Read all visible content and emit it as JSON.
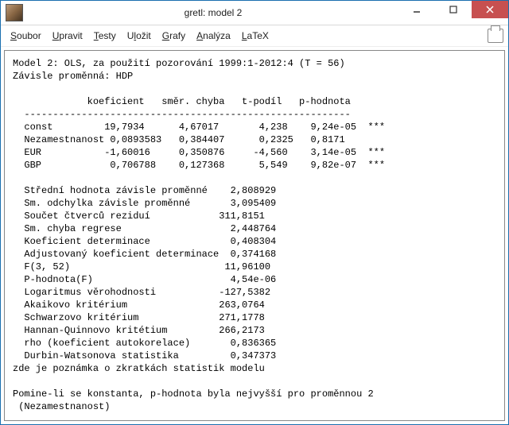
{
  "window": {
    "title": "gretl: model 2"
  },
  "menubar": {
    "soubor": "Soubor",
    "upravit": "Upravit",
    "testy": "Testy",
    "ulozit": "Uložit",
    "grafy": "Grafy",
    "analyza": "Analýza",
    "latex": "LaTeX"
  },
  "model": {
    "header1": "Model 2: OLS, za použití pozorování 1999:1-2012:4 (T = 56)",
    "header2": "Závisle proměnná: HDP",
    "colhead": "             koeficient   směr. chyba   t-podíl   p-hodnota",
    "rule": "  ---------------------------------------------------------",
    "rows": [
      "  const         19,7934      4,67017       4,238    9,24e-05  ***",
      "  Nezamestnanost 0,0893583   0,384407      0,2325   0,8171       ",
      "  EUR           -1,60016     0,350876     -4,560    3,14e-05  ***",
      "  GBP            0,706788    0,127368      5,549    9,82e-07  ***"
    ],
    "stats": [
      "Střední hodnota závisle proměnné    2,808929",
      "Sm. odchylka závisle proměnné       3,095409",
      "Součet čtverců reziduí            311,8151",
      "Sm. chyba regrese                   2,448764",
      "Koeficient determinace              0,408304",
      "Adjustovaný koeficient determinace  0,374168",
      "F(3, 52)                           11,96100",
      "P-hodnota(F)                        4,54e-06",
      "Logaritmus věrohodnosti           -127,5382",
      "Akaikovo kritérium                263,0764",
      "Schwarzovo kritérium              271,1778",
      "Hannan-Quinnovo kritétium         266,2173",
      "rho (koeficient autokorelace)       0,836365",
      "Durbin-Watsonova statistika         0,347373"
    ],
    "note": "zde je poznámka o zkratkách statistik modelu",
    "footer1": "Pomine-li se konstanta, p-hodnota byla nejvyšší pro proměnnou 2",
    "footer2": " (Nezamestnanost)"
  }
}
